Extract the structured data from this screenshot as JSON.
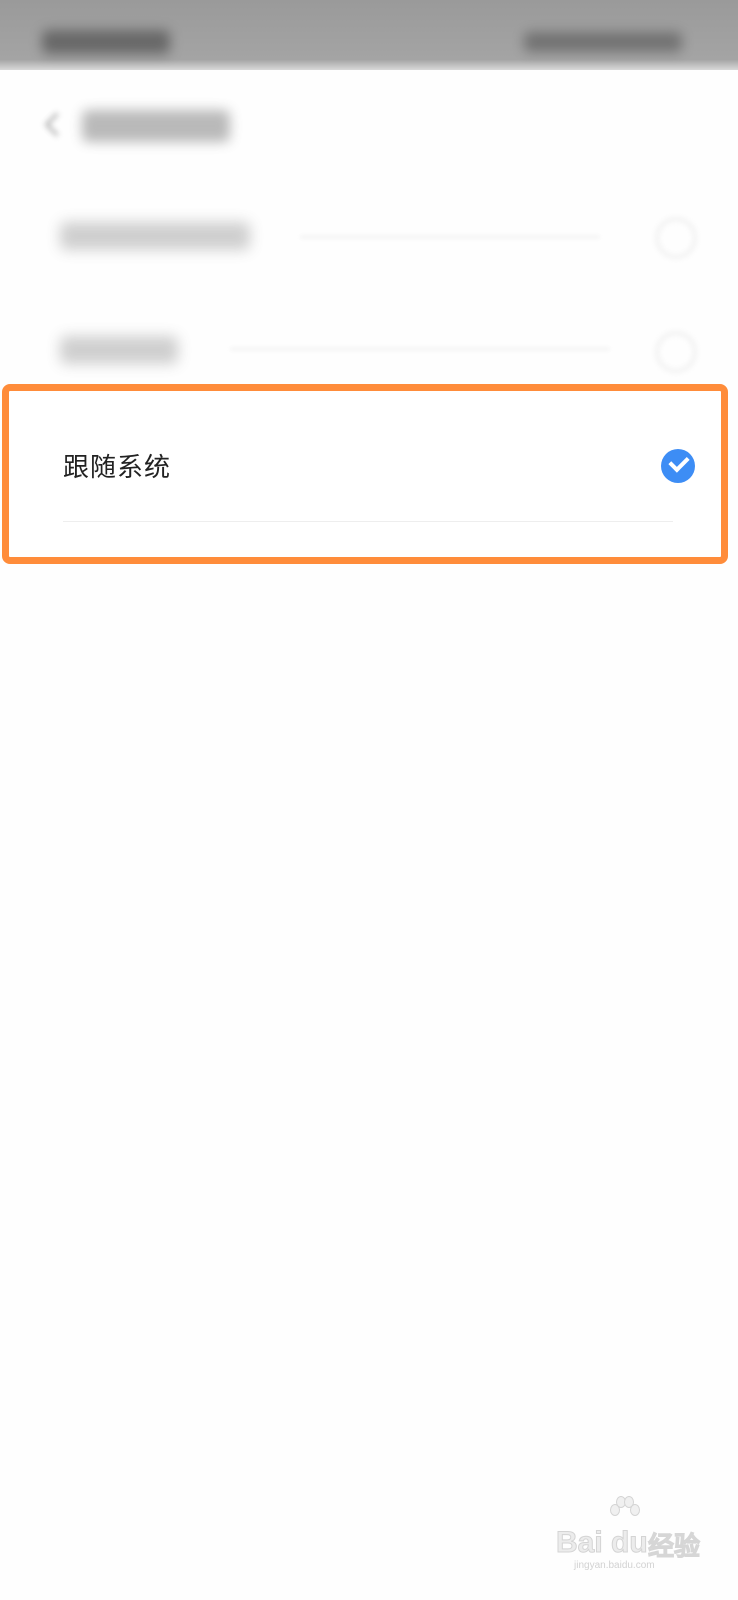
{
  "options": {
    "follow_system": {
      "label": "跟随系统",
      "selected": true
    }
  },
  "watermark": {
    "logo": "Bai du",
    "brand": "经验",
    "url": "jingyan.baidu.com"
  },
  "colors": {
    "highlight_border": "#ff8c3a",
    "check_accent": "#3d8df5"
  },
  "icons": {
    "check": "check-circle-icon",
    "back": "back-arrow-icon"
  }
}
